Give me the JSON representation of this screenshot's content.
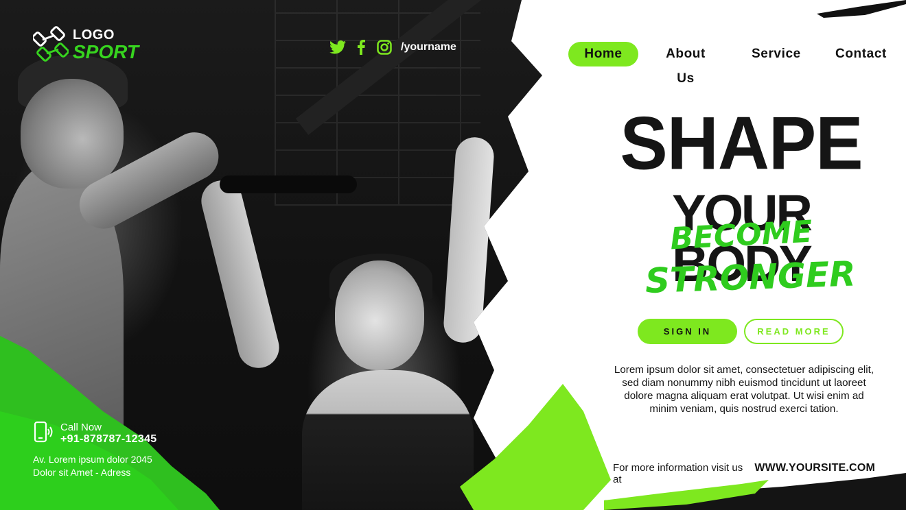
{
  "brand": {
    "logo_top": "LOGO",
    "logo_bottom": "SPORT"
  },
  "social": {
    "icons": [
      "twitter-icon",
      "facebook-icon",
      "instagram-icon"
    ],
    "handle": "/yourname"
  },
  "nav": {
    "items": [
      "Home",
      "About Us",
      "Service",
      "Contact"
    ],
    "active": "Home"
  },
  "hero": {
    "line1": "SHAPE",
    "line2": "YOUR BODY",
    "line3": "BECOME",
    "line4": "STRONGER"
  },
  "buttons": {
    "sign_in": "SIGN IN",
    "read_more": "READ MORE"
  },
  "description": "Lorem ipsum dolor sit amet, consectetuer adipiscing elit, sed diam nonummy nibh euismod tincidunt ut laoreet dolore magna aliquam erat volutpat. Ut wisi enim ad minim veniam, quis nostrud exerci tation.",
  "footer": {
    "more_info": "For more information visit us at",
    "site": "WWW.YOURSITE.COM"
  },
  "contact": {
    "call_label": "Call Now",
    "phone": "+91-878787-12345",
    "address_line1": "Av. Lorem ipsum dolor 2045",
    "address_line2": "Dolor sit Amet - Adress"
  },
  "colors": {
    "accent": "#7ee81f",
    "green": "#2fcc1e",
    "dark": "#151515"
  }
}
